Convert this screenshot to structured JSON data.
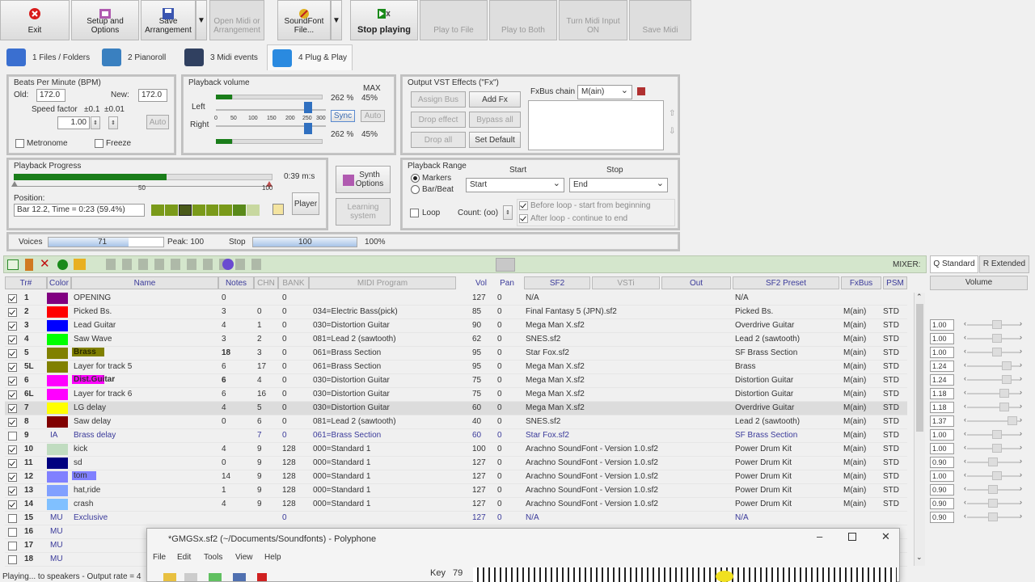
{
  "toolbar": {
    "exit": "Exit",
    "setup": "Setup and Options",
    "save": "Save Arrangement",
    "open_midi": "Open Midi or Arrangement",
    "soundfont": "SoundFont File...",
    "stop": "Stop playing",
    "play_file": "Play to File",
    "play_both": "Play to Both",
    "midi_input": "Turn Midi Input ON",
    "save_midi": "Save Midi"
  },
  "tabs": [
    "1 Files / Folders",
    "2 Pianoroll",
    "3 Midi events",
    "4 Plug & Play"
  ],
  "bpm": {
    "title": "Beats Per Minute (BPM)",
    "old_label": "Old:",
    "old": "172.0",
    "new_label": "New:",
    "new": "172.0",
    "speed_label": "Speed factor",
    "pm01": "±0.1",
    "pm001": "±0.01",
    "speed": "1.00",
    "auto": "Auto",
    "metronome": "Metronome",
    "freeze": "Freeze"
  },
  "volume": {
    "title": "Playback volume",
    "max": "MAX",
    "left": "Left",
    "right": "Right",
    "ticks": [
      "0",
      "50",
      "100",
      "150",
      "200",
      "250",
      "300"
    ],
    "left_pct": "262 %",
    "left_max": "45%",
    "right_pct": "262 %",
    "right_max": "45%",
    "sync": "Sync",
    "auto": "Auto"
  },
  "vst": {
    "title": "Output VST Effects (\"Fx\")",
    "assign_bus": "Assign Bus",
    "add_fx": "Add Fx",
    "drop_effect": "Drop effect",
    "bypass_all": "Bypass all",
    "drop_all": "Drop all",
    "set_default": "Set Default",
    "fxbus_label": "FxBus chain",
    "fxbus_value": "M(ain)"
  },
  "progress": {
    "title": "Playback Progress",
    "time": "0:39 m:s",
    "tick50": "50",
    "tick100": "100",
    "position_label": "Position:",
    "position": "Bar 12.2, Time = 0:23 (59.4%)",
    "fill": 0.59,
    "player": "Player",
    "synth_options": "Synth Options",
    "learning": "Learning system"
  },
  "range": {
    "title": "Playback Range",
    "markers": "Markers",
    "barbeat": "Bar/Beat",
    "start_label": "Start",
    "stop_label": "Stop",
    "start": "Start",
    "stop": "End",
    "loop": "Loop",
    "count": "Count: (oo)",
    "before": "Before loop - start from beginning",
    "after": "After loop - continue to end"
  },
  "voices": {
    "label": "Voices",
    "value": "71",
    "peak": "Peak: 100",
    "stop_label": "Stop",
    "stop_value": "100",
    "pct": "100%"
  },
  "mixer": {
    "label": "MIXER:",
    "tab_std": "Q Standard",
    "tab_ext": "R Extended",
    "volume": "Volume"
  },
  "headers": {
    "tr": "Tr#",
    "color": "Color",
    "name": "Name",
    "notes": "Notes",
    "chn": "CHN",
    "bank": "BANK",
    "prog": "MIDI Program",
    "vol": "Vol",
    "pan": "Pan",
    "sf2": "SF2",
    "vsti": "VSTi",
    "out": "Out",
    "preset": "SF2 Preset",
    "fxbus": "FxBus",
    "psm": "PSM"
  },
  "tracks": [
    {
      "tr": "1",
      "color": "#800080",
      "name": "OPENING",
      "notes": "0",
      "chn": "",
      "bank": "0",
      "prog": "",
      "vol": "127",
      "pan": "0",
      "sf2": "N/A",
      "preset": "N/A",
      "fx": "",
      "psm": "",
      "mix": "",
      "chk": true
    },
    {
      "tr": "2",
      "color": "#ff0000",
      "name": "Picked Bs.",
      "notes": "3",
      "chn": "0",
      "bank": "0",
      "prog": "034=Electric Bass(pick)",
      "vol": "85",
      "pan": "0",
      "sf2": "Final Fantasy 5 (JPN).sf2",
      "preset": "Picked Bs.",
      "fx": "M(ain)",
      "psm": "STD",
      "mix": "1.00",
      "chk": true
    },
    {
      "tr": "3",
      "color": "#0000ff",
      "name": "Lead Guitar",
      "notes": "4",
      "chn": "1",
      "bank": "0",
      "prog": "030=Distortion Guitar",
      "vol": "90",
      "pan": "0",
      "sf2": "Mega Man X.sf2",
      "preset": "Overdrive Guitar",
      "fx": "M(ain)",
      "psm": "STD",
      "mix": "1.00",
      "chk": true
    },
    {
      "tr": "4",
      "color": "#00ff00",
      "name": "Saw Wave",
      "notes": "3",
      "chn": "2",
      "bank": "0",
      "prog": "081=Lead 2 (sawtooth)",
      "vol": "62",
      "pan": "0",
      "sf2": "SNES.sf2",
      "preset": "Lead 2 (sawtooth)",
      "fx": "M(ain)",
      "psm": "STD",
      "mix": "1.00",
      "chk": true
    },
    {
      "tr": "5",
      "color": "#808000",
      "name": "Brass",
      "notes": "18",
      "chn": "3",
      "bank": "0",
      "prog": "061=Brass Section",
      "vol": "95",
      "pan": "0",
      "sf2": "Star Fox.sf2",
      "preset": "SF Brass Section",
      "fx": "M(ain)",
      "psm": "STD",
      "mix": "1.24",
      "chk": true,
      "bold": true
    },
    {
      "tr": "5L",
      "color": "#808000",
      "name": "Layer for track 5",
      "notes": "6",
      "chn": "17",
      "bank": "0",
      "prog": "061=Brass Section",
      "vol": "95",
      "pan": "0",
      "sf2": "Mega Man X.sf2",
      "preset": "Brass",
      "fx": "M(ain)",
      "psm": "STD",
      "mix": "1.24",
      "chk": true,
      "layer": true
    },
    {
      "tr": "6",
      "color": "#ff00ff",
      "name": "Dist.Guitar",
      "notes": "6",
      "chn": "4",
      "bank": "0",
      "prog": "030=Distortion Guitar",
      "vol": "75",
      "pan": "0",
      "sf2": "Mega Man X.sf2",
      "preset": "Distortion Guitar",
      "fx": "M(ain)",
      "psm": "STD",
      "mix": "1.18",
      "chk": true,
      "bold": true
    },
    {
      "tr": "6L",
      "color": "#ff00ff",
      "name": "Layer for track 6",
      "notes": "6",
      "chn": "16",
      "bank": "0",
      "prog": "030=Distortion Guitar",
      "vol": "75",
      "pan": "0",
      "sf2": "Mega Man X.sf2",
      "preset": "Distortion Guitar",
      "fx": "M(ain)",
      "psm": "STD",
      "mix": "1.18",
      "chk": true,
      "layer": true
    },
    {
      "tr": "7",
      "color": "#ffff00",
      "name": "LG delay",
      "notes": "4",
      "chn": "5",
      "bank": "0",
      "prog": "030=Distortion Guitar",
      "vol": "60",
      "pan": "0",
      "sf2": "Mega Man X.sf2",
      "preset": "Overdrive Guitar",
      "fx": "M(ain)",
      "psm": "STD",
      "mix": "1.37",
      "chk": true,
      "sel": true
    },
    {
      "tr": "8",
      "color": "#800000",
      "name": "Saw delay",
      "notes": "0",
      "chn": "6",
      "bank": "0",
      "prog": "081=Lead 2 (sawtooth)",
      "vol": "40",
      "pan": "0",
      "sf2": "SNES.sf2",
      "preset": "Lead 2 (sawtooth)",
      "fx": "M(ain)",
      "psm": "STD",
      "mix": "1.00",
      "chk": true
    },
    {
      "tr": "9",
      "color": "",
      "ctext": "IA",
      "name": "Brass delay",
      "notes": "",
      "chn": "7",
      "bank": "0",
      "prog": "061=Brass Section",
      "vol": "60",
      "pan": "0",
      "sf2": "Star Fox.sf2",
      "preset": "SF Brass Section",
      "fx": "M(ain)",
      "psm": "STD",
      "mix": "1.00",
      "chk": false,
      "blue": true
    },
    {
      "tr": "10",
      "color": "#c0dcc0",
      "name": "kick",
      "notes": "4",
      "chn": "9",
      "bank": "128",
      "prog": "000=Standard 1",
      "vol": "100",
      "pan": "0",
      "sf2": "Arachno SoundFont - Version 1.0.sf2",
      "preset": "Power Drum Kit",
      "fx": "M(ain)",
      "psm": "STD",
      "mix": "0.90",
      "chk": true
    },
    {
      "tr": "11",
      "color": "#000080",
      "name": "sd",
      "notes": "0",
      "chn": "9",
      "bank": "128",
      "prog": "000=Standard 1",
      "vol": "127",
      "pan": "0",
      "sf2": "Arachno SoundFont - Version 1.0.sf2",
      "preset": "Power Drum Kit",
      "fx": "M(ain)",
      "psm": "STD",
      "mix": "1.00",
      "chk": true
    },
    {
      "tr": "12",
      "color": "#8080ff",
      "name": "tom",
      "notes": "14",
      "chn": "9",
      "bank": "128",
      "prog": "000=Standard 1",
      "vol": "127",
      "pan": "0",
      "sf2": "Arachno SoundFont - Version 1.0.sf2",
      "preset": "Power Drum Kit",
      "fx": "M(ain)",
      "psm": "STD",
      "mix": "0.90",
      "chk": true,
      "wide": true
    },
    {
      "tr": "13",
      "color": "#80a0ff",
      "name": "hat,ride",
      "notes": "1",
      "chn": "9",
      "bank": "128",
      "prog": "000=Standard 1",
      "vol": "127",
      "pan": "0",
      "sf2": "Arachno SoundFont - Version 1.0.sf2",
      "preset": "Power Drum Kit",
      "fx": "M(ain)",
      "psm": "STD",
      "mix": "0.90",
      "chk": true
    },
    {
      "tr": "14",
      "color": "#80c0ff",
      "name": "crash",
      "notes": "4",
      "chn": "9",
      "bank": "128",
      "prog": "000=Standard 1",
      "vol": "127",
      "pan": "0",
      "sf2": "Arachno SoundFont - Version 1.0.sf2",
      "preset": "Power Drum Kit",
      "fx": "M(ain)",
      "psm": "STD",
      "mix": "0.90",
      "chk": true
    },
    {
      "tr": "15",
      "color": "",
      "ctext": "MU",
      "name": "Exclusive",
      "notes": "",
      "chn": "",
      "bank": "0",
      "prog": "",
      "vol": "127",
      "pan": "0",
      "sf2": "N/A",
      "preset": "N/A",
      "fx": "",
      "psm": "",
      "mix": "",
      "chk": false,
      "blue": true
    },
    {
      "tr": "16",
      "color": "",
      "ctext": "MU",
      "name": "",
      "notes": "",
      "chn": "",
      "bank": "",
      "prog": "",
      "vol": "",
      "pan": "",
      "sf2": "",
      "preset": "",
      "fx": "",
      "psm": "",
      "mix": "",
      "chk": false
    },
    {
      "tr": "17",
      "color": "",
      "ctext": "MU",
      "name": "",
      "notes": "",
      "chn": "",
      "bank": "",
      "prog": "",
      "vol": "",
      "pan": "",
      "sf2": "",
      "preset": "",
      "fx": "",
      "psm": "",
      "mix": "",
      "chk": false
    },
    {
      "tr": "18",
      "color": "",
      "ctext": "MU",
      "name": "",
      "notes": "",
      "chn": "",
      "bank": "",
      "prog": "",
      "vol": "",
      "pan": "",
      "sf2": "",
      "preset": "",
      "fx": "",
      "psm": "",
      "mix": "",
      "chk": false
    }
  ],
  "status": "Playing... to speakers - Output rate = 4",
  "key": {
    "label": "Key",
    "value": "79"
  },
  "polyphone": {
    "title": "*GMGSx.sf2 (~/Documents/Soundfonts) - Polyphone",
    "menu": [
      "File",
      "Edit",
      "Tools",
      "View",
      "Help"
    ]
  }
}
